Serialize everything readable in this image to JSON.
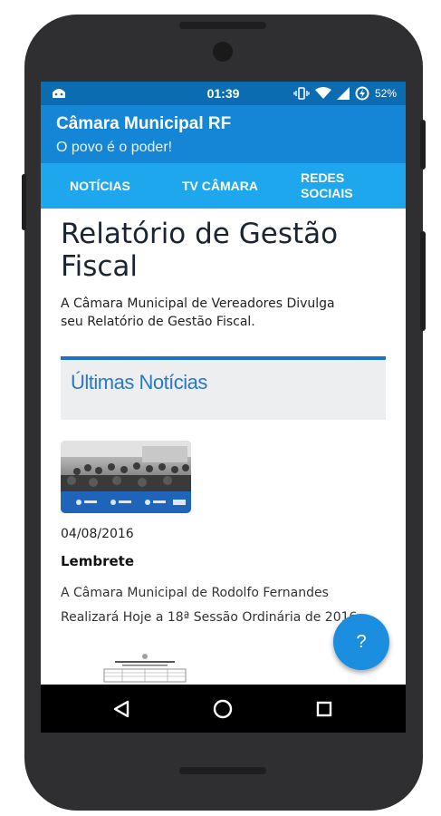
{
  "status_bar": {
    "time": "01:39",
    "battery_percent": "52%"
  },
  "app_bar": {
    "title": "Câmara Municipal RF",
    "subtitle": "O povo é o poder!"
  },
  "tabs": [
    {
      "label": "NOTÍCIAS",
      "selected": true
    },
    {
      "label": "TV CÂMARA",
      "selected": false
    },
    {
      "label_line1": "REDES",
      "label_line2": "SOCIAIS",
      "selected": false
    }
  ],
  "page": {
    "title_line1": "Relatório de Gestão",
    "title_line2": "Fiscal",
    "description_line1": "A Câmara Municipal de Vereadores Divulga",
    "description_line2": "seu Relatório de Gestão Fiscal."
  },
  "news_section": {
    "title": "Últimas Notícias"
  },
  "news": [
    {
      "date": "04/08/2016",
      "title": "Lembrete",
      "text_line1": "A Câmara Municipal de Rodolfo Fernandes",
      "text_line2": "Realizará Hoje a 18ª Sessão Ordinária de 2016"
    }
  ],
  "fab": {
    "label": "?"
  },
  "colors": {
    "status_bar": "#0b6cb1",
    "app_bar": "#1585d6",
    "tab_bar": "#1fa7ee",
    "fab": "#1c8ee0",
    "accent": "#1a73c8"
  },
  "icons": {
    "status_left": "android-debug-icon",
    "status_right": [
      "vibrate-icon",
      "wifi-icon",
      "signal-icon",
      "battery-charging-icon"
    ],
    "nav": [
      "back-triangle-icon",
      "home-circle-icon",
      "recents-square-icon"
    ]
  }
}
